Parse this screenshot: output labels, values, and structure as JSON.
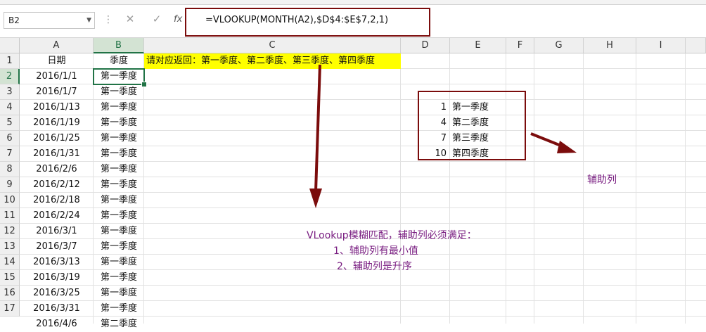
{
  "toolbar": {
    "name_box": "B2",
    "formula": "=VLOOKUP(MONTH(A2),$D$4:$E$7,2,1)",
    "fx_label": "fx"
  },
  "columns": [
    "A",
    "B",
    "C",
    "D",
    "E",
    "F",
    "G",
    "H",
    "I"
  ],
  "rows": [
    "1",
    "2",
    "3",
    "4",
    "5",
    "6",
    "7",
    "8",
    "9",
    "10",
    "11",
    "12",
    "13",
    "14",
    "15",
    "16",
    "17"
  ],
  "header_row": {
    "a1": "日期",
    "b1": "季度",
    "c1": "请对应返回：第一季度、第二季度、第三季度、第四季度"
  },
  "dates": [
    "2016/1/1",
    "2016/1/7",
    "2016/1/13",
    "2016/1/19",
    "2016/1/25",
    "2016/1/31",
    "2016/2/6",
    "2016/2/12",
    "2016/2/18",
    "2016/2/24",
    "2016/3/1",
    "2016/3/7",
    "2016/3/13",
    "2016/3/19",
    "2016/3/25",
    "2016/3/31",
    "2016/4/6"
  ],
  "quarters": [
    "第一季度",
    "第一季度",
    "第一季度",
    "第一季度",
    "第一季度",
    "第一季度",
    "第一季度",
    "第一季度",
    "第一季度",
    "第一季度",
    "第一季度",
    "第一季度",
    "第一季度",
    "第一季度",
    "第一季度",
    "第一季度",
    "第二季度"
  ],
  "lookup_table": [
    {
      "month": "1",
      "quarter": "第一季度"
    },
    {
      "month": "4",
      "quarter": "第二季度"
    },
    {
      "month": "7",
      "quarter": "第三季度"
    },
    {
      "month": "10",
      "quarter": "第四季度"
    }
  ],
  "notes": {
    "helper": "辅助列",
    "line1": "VLookup模糊匹配，辅助列必须满足：",
    "line2": "1、辅助列有最小值",
    "line3": "2、辅助列是升序"
  },
  "colors": {
    "accent": "#217346",
    "annotation": "#7b0c0c",
    "highlight": "#ffff00",
    "note_text": "#7a1f82"
  }
}
